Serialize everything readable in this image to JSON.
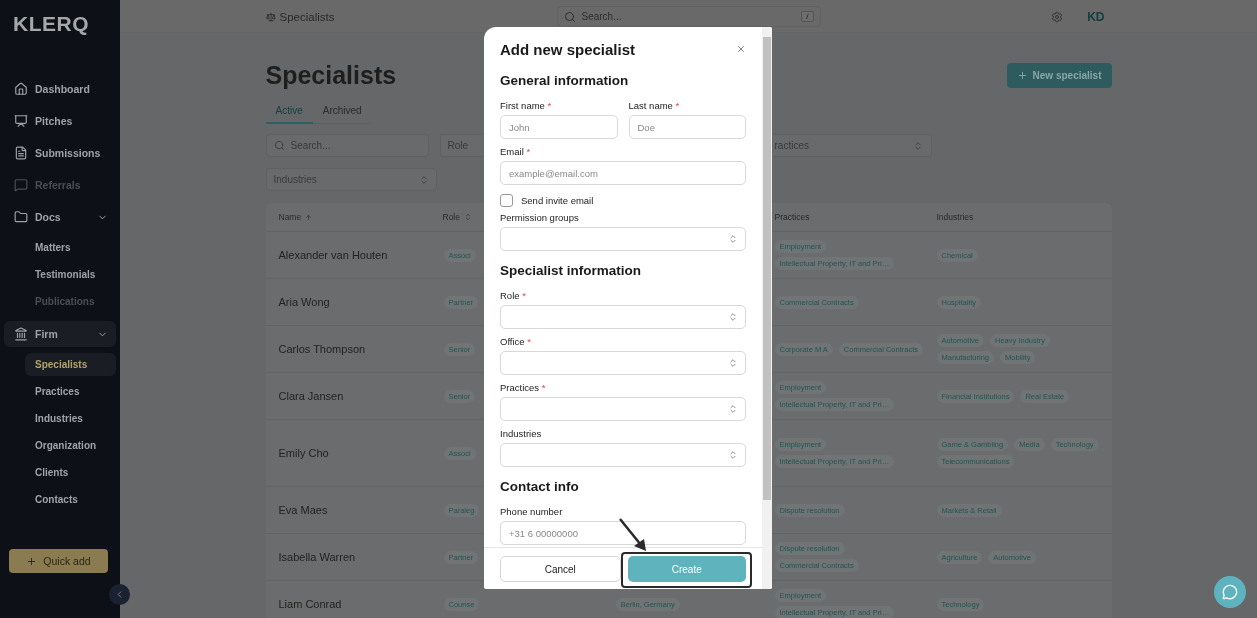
{
  "app": {
    "logo": "KLERQ"
  },
  "sidebar": {
    "items": [
      {
        "label": "Dashboard",
        "selected": false,
        "disabled": false
      },
      {
        "label": "Pitches",
        "selected": false,
        "disabled": false
      },
      {
        "label": "Submissions",
        "selected": false,
        "disabled": false
      },
      {
        "label": "Referrals",
        "selected": false,
        "disabled": true
      },
      {
        "label": "Docs",
        "selected": false,
        "disabled": false,
        "expanded": true,
        "children": [
          {
            "label": "Matters",
            "selected": false,
            "disabled": false
          },
          {
            "label": "Testimonials",
            "selected": false,
            "disabled": false
          },
          {
            "label": "Publications",
            "selected": false,
            "disabled": true
          }
        ]
      },
      {
        "label": "Firm",
        "selected": true,
        "disabled": false,
        "expanded": true,
        "children": [
          {
            "label": "Specialists",
            "selected": true,
            "disabled": false
          },
          {
            "label": "Practices",
            "selected": false,
            "disabled": false
          },
          {
            "label": "Industries",
            "selected": false,
            "disabled": false
          },
          {
            "label": "Organization",
            "selected": false,
            "disabled": false
          },
          {
            "label": "Clients",
            "selected": false,
            "disabled": false
          },
          {
            "label": "Contacts",
            "selected": false,
            "disabled": false
          }
        ]
      }
    ],
    "quick_add": "Quick add"
  },
  "topbar": {
    "breadcrumb": "Specialists",
    "search": {
      "placeholder": "Search...",
      "shortcut": "/"
    },
    "avatar": "KD"
  },
  "page": {
    "title": "Specialists",
    "new_button": "New specialist",
    "tabs": [
      {
        "label": "Active",
        "selected": true
      },
      {
        "label": "Archived",
        "selected": false
      }
    ],
    "filters": {
      "search": {
        "placeholder": "Search..."
      },
      "role": {
        "placeholder": "Role"
      },
      "practices": {
        "placeholder": "ractices"
      },
      "industries": {
        "placeholder": "Industries"
      }
    },
    "table": {
      "columns": [
        {
          "label": "Name",
          "sorted": true
        },
        {
          "label": "Role",
          "sorted": false
        },
        {
          "label": "Practices"
        },
        {
          "label": "Industries"
        }
      ],
      "rows": [
        {
          "name": "Alexander van Houten",
          "role": "Associ",
          "practices": [
            "Employment",
            "Intellectual Property, IT and Pri…"
          ],
          "industries": [
            "Chemical"
          ]
        },
        {
          "name": "Aria Wong",
          "role": "Partner",
          "practices": [
            "Commercial Contracts"
          ],
          "industries": [
            "Hospitality"
          ]
        },
        {
          "name": "Carlos Thompson",
          "role": "Senior",
          "practices": [
            "Corporate M A",
            "Commercial Contracts"
          ],
          "industries": [
            "Automotive",
            "Heavy Industry",
            "Manufacturing",
            "Mobility"
          ]
        },
        {
          "name": "Clara Jansen",
          "role": "Senior",
          "practices": [
            "Employment",
            "Intellectual Property, IT and Pri…"
          ],
          "industries": [
            "Financial Institutions",
            "Real Estate"
          ]
        },
        {
          "name": "Emily Cho",
          "role": "Associ",
          "practices": [
            "Employment",
            "Intellectual Property, IT and Pri…"
          ],
          "industries": [
            "Game & Gambling",
            "Media",
            "Technology",
            "Telecommunications"
          ]
        },
        {
          "name": "Eva Maes",
          "role": "Paraleg",
          "practices": [
            "Dispute resolution"
          ],
          "industries": [
            "Markets & Retail"
          ]
        },
        {
          "name": "Isabella Warren",
          "role": "Partner",
          "practices": [
            "Dispute resolution",
            "Commercial Contracts"
          ],
          "industries": [
            "Agriculture",
            "Automotive"
          ]
        },
        {
          "name": "Liam Conrad",
          "role": "Counse",
          "office": "Berlin, Germany",
          "practices": [
            "Employment",
            "Intellectual Property, IT and Pri…"
          ],
          "industries": [
            "Technology"
          ]
        }
      ]
    }
  },
  "dialog": {
    "title": "Add new specialist",
    "sections": [
      {
        "title": "General information",
        "fields": [
          {
            "kind": "row",
            "fields": [
              {
                "kind": "text",
                "label": "First name",
                "required_mark": "*",
                "placeholder": "John"
              },
              {
                "kind": "text",
                "label": "Last name",
                "required_mark": "*",
                "placeholder": "Doe"
              }
            ]
          },
          {
            "kind": "text",
            "label": "Email",
            "required_mark": "*",
            "placeholder": "example@email.com"
          },
          {
            "kind": "checkbox",
            "label": "Send invite email",
            "checked": false
          },
          {
            "kind": "select",
            "label": "Permission groups"
          }
        ]
      },
      {
        "title": "Specialist information",
        "fields": [
          {
            "kind": "select",
            "label": "Role",
            "required_mark": "*"
          },
          {
            "kind": "select",
            "label": "Office",
            "required_mark": "*"
          },
          {
            "kind": "select",
            "label": "Practices",
            "required_mark": "*"
          },
          {
            "kind": "select",
            "label": "Industries"
          }
        ]
      },
      {
        "title": "Contact info",
        "fields": [
          {
            "kind": "text",
            "label": "Phone number",
            "placeholder": "+31 6 00000000"
          }
        ]
      }
    ],
    "cancel": "Cancel",
    "create": "Create"
  }
}
